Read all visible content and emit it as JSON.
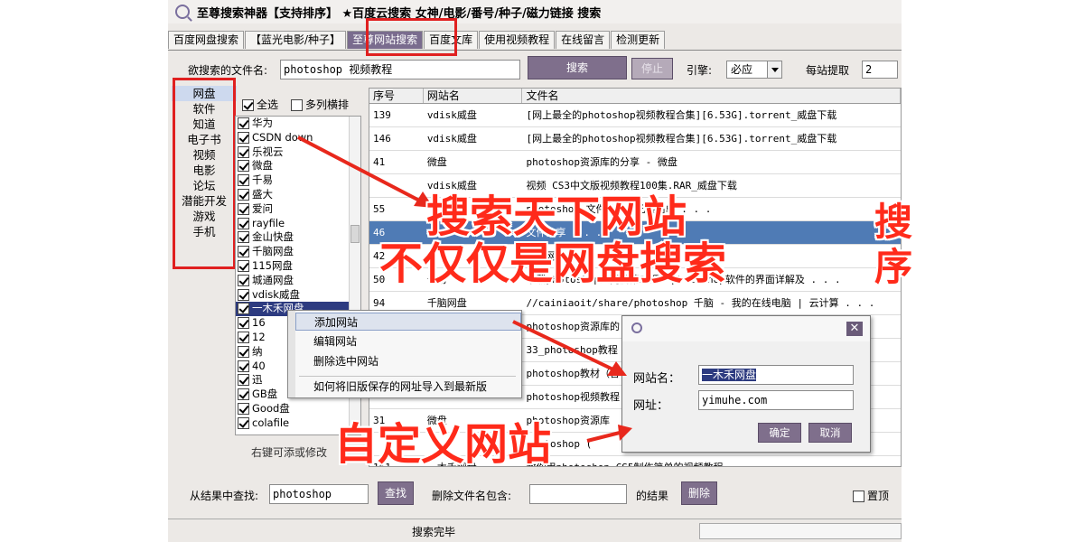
{
  "window": {
    "title": "至尊搜索神器【支持排序】 ★百度云搜索  女神/电影/番号/种子/磁力链接  搜索"
  },
  "tabs": [
    {
      "label": "百度网盘搜索"
    },
    {
      "label": "【蓝光电影/种子】"
    },
    {
      "label": "至尊网站搜索"
    },
    {
      "label": "百度文库"
    },
    {
      "label": "使用视频教程"
    },
    {
      "label": "在线留言"
    },
    {
      "label": "检测更新"
    }
  ],
  "search": {
    "label": "欲搜索的文件名:",
    "value": "photoshop 视频教程",
    "search_button": "搜索",
    "stop_button": "停止",
    "engine_label": "引擎:",
    "engine_value": "必应",
    "per_site_label": "每站提取",
    "per_site_value": "2"
  },
  "categories": [
    "网盘",
    "软件",
    "知道",
    "电子书",
    "视频",
    "电影",
    "论坛",
    "潜能开发",
    "游戏",
    "手机"
  ],
  "site_panel": {
    "select_all": "全选",
    "multi_sort": "多列横排",
    "sites": [
      "华为",
      "CSDN down",
      "乐视云",
      "微盘",
      "千易",
      "盛大",
      "爱问",
      "rayfile",
      "金山快盘",
      "千脑网盘",
      "115网盘",
      "城通网盘",
      "vdisk威盘",
      "一木禾网盘",
      "16",
      "12",
      "纳",
      "40",
      "迅",
      "GB盘",
      "Good盘",
      "colafile"
    ],
    "hint": "右键可添或修改"
  },
  "grid": {
    "headers": [
      "序号",
      "网站名",
      "文件名"
    ],
    "rows": [
      {
        "no": "139",
        "site": "vdisk威盘",
        "file": "[网上最全的photoshop视频教程合集][6.53G].torrent_威盘下载"
      },
      {
        "no": "146",
        "site": "vdisk威盘",
        "file": "[网上最全的photoshop视频教程合集][6.53G].torrent_威盘下载"
      },
      {
        "no": "41",
        "site": "微盘",
        "file": "photoshop资源库的分享 - 微盘"
      },
      {
        "no": "",
        "site": "vdisk威盘",
        "file": "视频 CS3中文版视频教程100集.RAR_威盘下载"
      },
      {
        "no": "55",
        "site": "",
        "file": "photoshop 文件分享，无限简单 . . ."
      },
      {
        "no": "46",
        "site": "",
        "file": "   文件分享 . . ."
      },
      {
        "no": "42",
        "site": "",
        "file": "千易网盘 . . ."
      },
      {
        "no": "50",
        "site": "千易",
        "file": "下载photoshop入门篇第二课--photoshop软件的界面详解及 . . ."
      },
      {
        "no": "94",
        "site": "千脑网盘",
        "file": "//cainiaoit/share/photoshop 千脑 - 我的在线电脑 | 云计算 . . ."
      },
      {
        "no": "",
        "site": "",
        "file": "photoshop资源库的"
      },
      {
        "no": "",
        "site": "",
        "file": "33_photoshop教程"
      },
      {
        "no": "",
        "site": "",
        "file": "photoshop教材（含"
      },
      {
        "no": "",
        "site": "",
        "file": "photoshop视频教程"
      },
      {
        "no": "31",
        "site": "微盘",
        "file": "photoshop资源库"
      },
      {
        "no": "",
        "site": "",
        "file": "photoshop ("
      },
      {
        "no": "161",
        "site": "一木禾网盘",
        "file": "教你用photoshop CS5制作简单的视频教程 . . ."
      }
    ]
  },
  "context_menu": {
    "items": [
      "添加网站",
      "编辑网站",
      "删除选中网站",
      "如何将旧版保存的网址导入到最新版"
    ]
  },
  "dialog": {
    "name_label": "网站名：",
    "name_value": "一木禾网盘",
    "url_label": "网址：",
    "url_value": "yimuhe.com",
    "ok": "确定",
    "cancel": "取消"
  },
  "bottom": {
    "find_label": "从结果中查找:",
    "find_value": "photoshop",
    "find_button": "查找",
    "delete_label": "删除文件名包含:",
    "delete_suffix": "的结果",
    "delete_button": "删除",
    "pin_label": "置顶",
    "status": "搜索完毕"
  },
  "annotations": {
    "line1": "搜索天下网站",
    "line2": "不仅仅是网盘搜索",
    "line3": "自定义网站",
    "edge1": "搜",
    "edge2": "序"
  },
  "colors": {
    "annotation": "#ff2a1a",
    "accent_button": "#7f6f8c",
    "selection": "#4f7bb5"
  }
}
